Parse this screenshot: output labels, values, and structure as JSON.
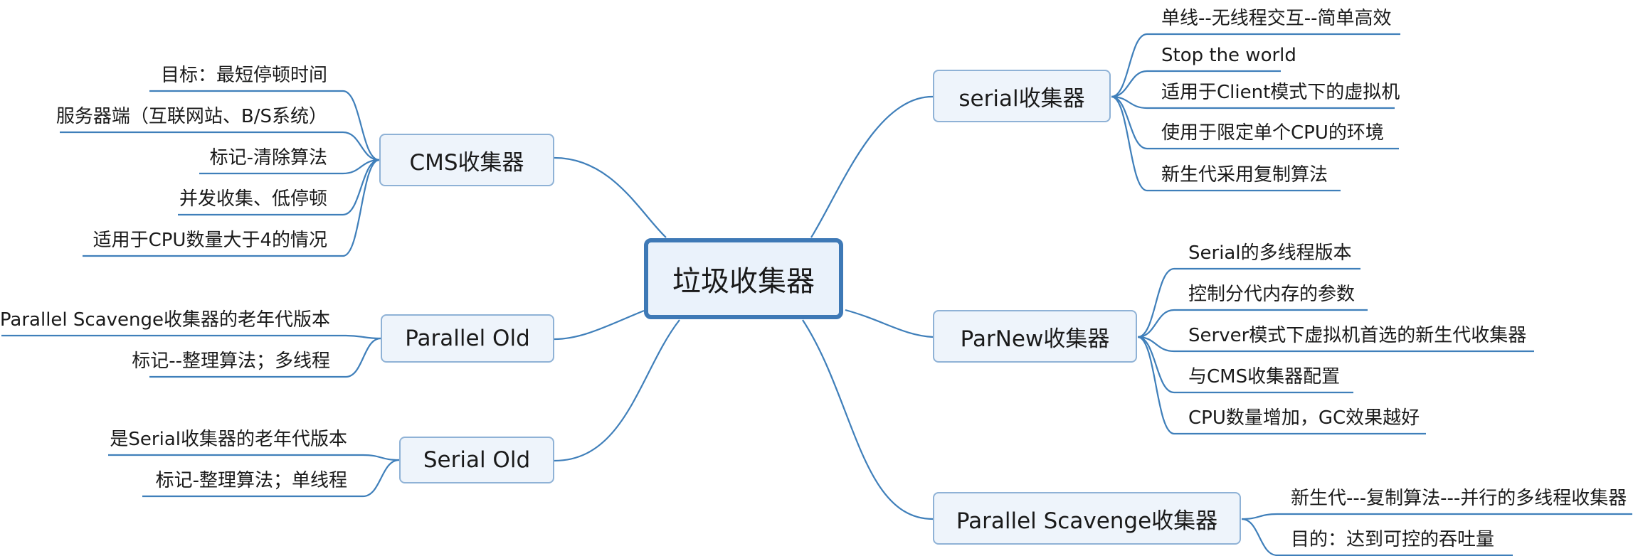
{
  "root": {
    "label": "垃圾收集器"
  },
  "branches": [
    {
      "label": "serial收集器",
      "leaves": [
        "单线--无线程交互--简单高效",
        "Stop the world",
        "适用于Client模式下的虚拟机",
        "使用于限定单个CPU的环境",
        "新生代采用复制算法"
      ]
    },
    {
      "label": "ParNew收集器",
      "leaves": [
        "Serial的多线程版本",
        "控制分代内存的参数",
        "Server模式下虚拟机首选的新生代收集器",
        "与CMS收集器配置",
        "CPU数量增加，GC效果越好"
      ]
    },
    {
      "label": "Parallel Scavenge收集器",
      "leaves": [
        "新生代---复制算法---并行的多线程收集器",
        "目的：达到可控的吞吐量"
      ]
    },
    {
      "label": "CMS收集器",
      "leaves": [
        "目标：最短停顿时间",
        "服务器端（互联网站、B/S系统）",
        "标记-清除算法",
        "并发收集、低停顿",
        "适用于CPU数量大于4的情况"
      ]
    },
    {
      "label": "Parallel Old",
      "leaves": [
        "Parallel Scavenge收集器的老年代版本",
        "标记--整理算法；多线程"
      ]
    },
    {
      "label": "Serial Old",
      "leaves": [
        "是Serial收集器的老年代版本",
        "标记-整理算法；单线程"
      ]
    }
  ],
  "colors": {
    "line": "#3f7fba",
    "root_border": "#3e79b6",
    "root_fill": "#eaf2fb",
    "branch_border": "#8fb2d6",
    "branch_fill": "#eef4fb"
  }
}
